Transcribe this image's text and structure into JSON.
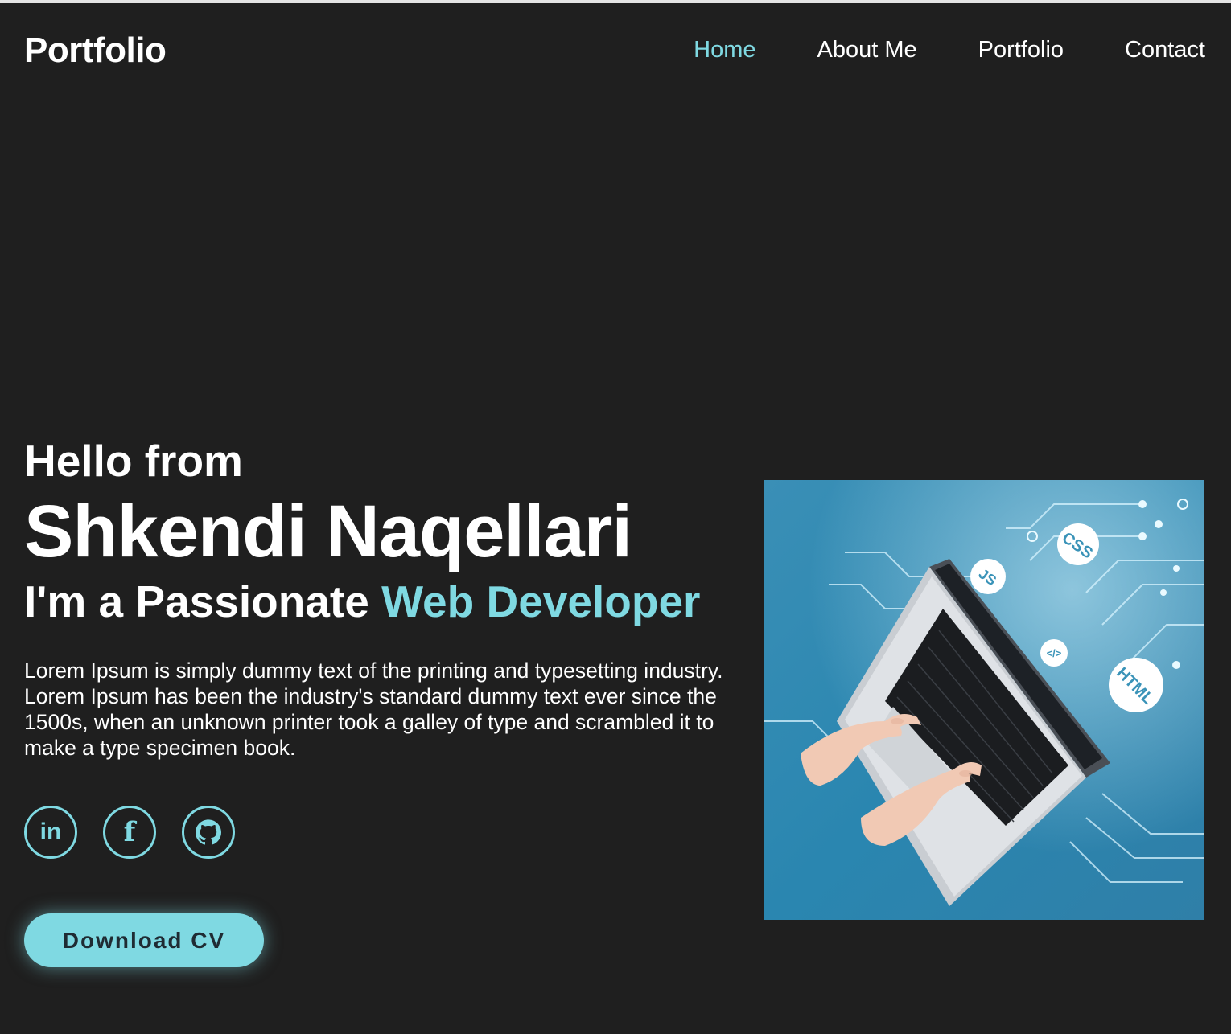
{
  "header": {
    "logo": "Portfolio",
    "nav": [
      {
        "label": "Home",
        "active": true
      },
      {
        "label": "About Me",
        "active": false
      },
      {
        "label": "Portfolio",
        "active": false
      },
      {
        "label": "Contact",
        "active": false
      }
    ]
  },
  "hero": {
    "greeting": "Hello from",
    "name": "Shkendi Naqellari",
    "role_prefix": "I'm a Passionate",
    "role_highlight": "Web Developer",
    "description": "Lorem Ipsum is simply dummy text of the printing and typesetting industry. Lorem Ipsum has been the industry's standard dummy text ever since the 1500s, when an unknown printer took a galley of type and scrambled it to make a type specimen book.",
    "socials": [
      {
        "icon": "linkedin-icon",
        "glyph": "in"
      },
      {
        "icon": "facebook-icon",
        "glyph": "f"
      },
      {
        "icon": "github-icon",
        "glyph": ""
      }
    ],
    "cv_button": "Download CV",
    "image": {
      "icon": "laptop-coding-illustration",
      "badges": [
        "JS",
        "CSS",
        "HTML",
        "</>"
      ]
    }
  },
  "colors": {
    "background": "#1f1f1f",
    "accent": "#7fd9e2",
    "text": "#ffffff",
    "image_bg": "#2f86ad"
  }
}
